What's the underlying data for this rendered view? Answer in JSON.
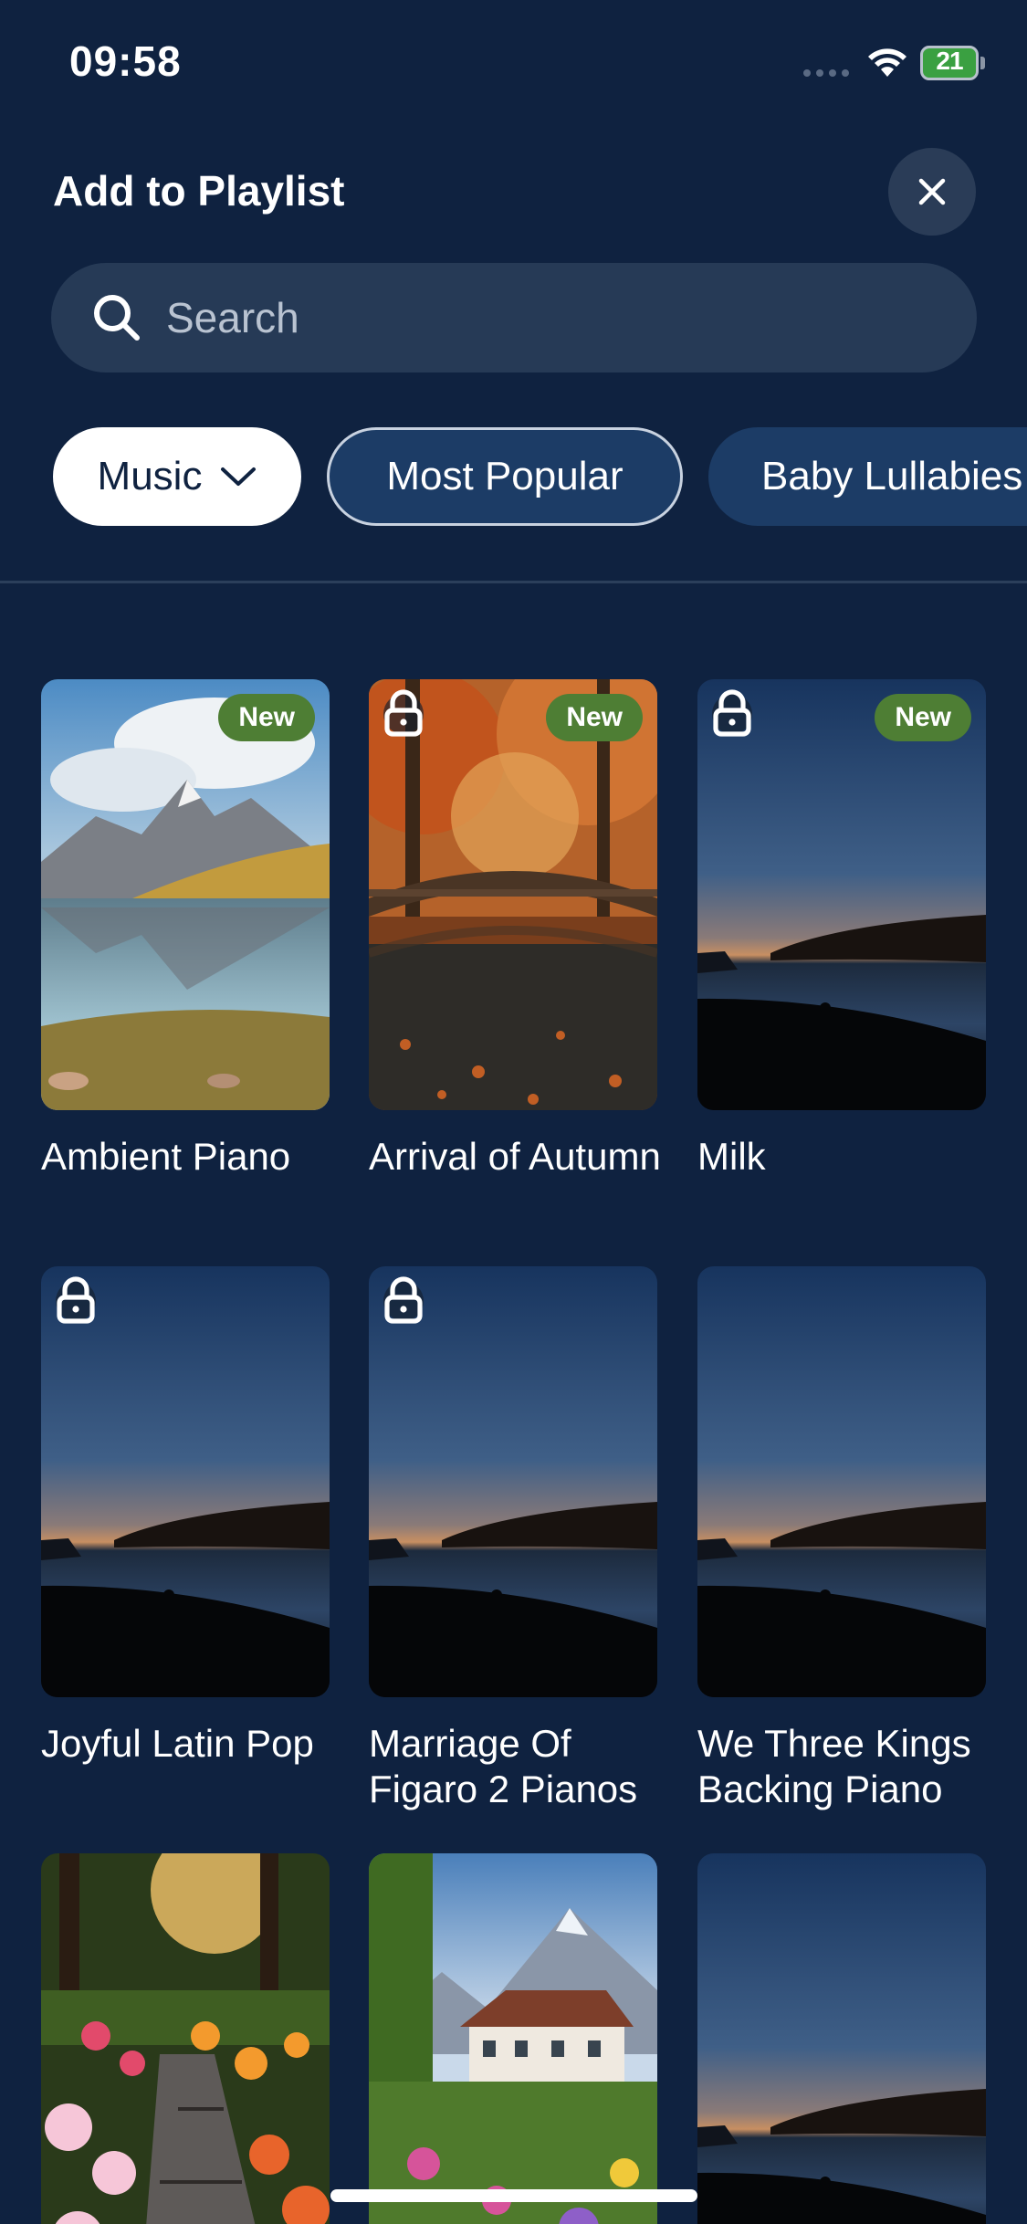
{
  "status_bar": {
    "time": "09:58",
    "battery": "21"
  },
  "header": {
    "title": "Add to Playlist"
  },
  "search": {
    "placeholder": "Search"
  },
  "chips": [
    {
      "label": "Music"
    },
    {
      "label": "Most Popular"
    },
    {
      "label": "Baby Lullabies"
    }
  ],
  "items": [
    {
      "title": "Ambient Piano",
      "badge": "New",
      "locked": false,
      "image": "mountain-lake"
    },
    {
      "title": "Arrival of Autumn",
      "badge": "New",
      "locked": true,
      "image": "autumn-bridge"
    },
    {
      "title": "Milk",
      "badge": "New",
      "locked": true,
      "image": "lake-dusk"
    },
    {
      "title": "Joyful Latin Pop",
      "badge": "",
      "locked": true,
      "image": "lake-dusk"
    },
    {
      "title": "Marriage Of Figaro 2 Pianos",
      "badge": "",
      "locked": true,
      "image": "lake-dusk"
    },
    {
      "title": "We Three Kings Backing Piano",
      "badge": "",
      "locked": false,
      "image": "lake-dusk"
    },
    {
      "title": "",
      "badge": "",
      "locked": false,
      "image": "flower-path"
    },
    {
      "title": "",
      "badge": "",
      "locked": false,
      "image": "alpine-house"
    },
    {
      "title": "",
      "badge": "",
      "locked": false,
      "image": "lake-dusk"
    }
  ],
  "colors": {
    "background": "#0f2240",
    "badge": "#4e7e34",
    "chip_active": "#ffffff",
    "chip": "#1c3c66"
  }
}
